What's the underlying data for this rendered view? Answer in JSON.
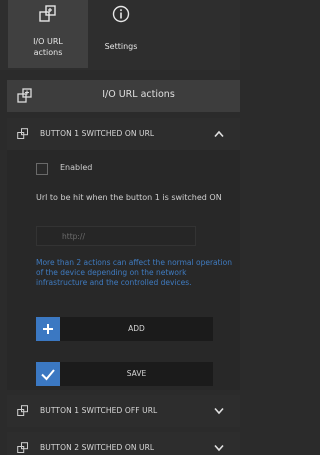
{
  "tabs": [
    {
      "label_line1": "I/O URL",
      "label_line2": "actions"
    },
    {
      "label": "Settings"
    }
  ],
  "section": {
    "title": "I/O URL actions"
  },
  "accordion": [
    {
      "title": "BUTTON 1 SWITCHED ON URL",
      "expanded": true
    },
    {
      "title": "BUTTON 1 SWITCHED OFF URL",
      "expanded": false
    },
    {
      "title": "BUTTON 2 SWITCHED ON URL",
      "expanded": false
    }
  ],
  "form": {
    "enabled_label": "Enabled",
    "enabled_checked": false,
    "url_label": "Url to be hit when the button 1 is switched ON",
    "url_placeholder": "http://",
    "warning": "More than 2 actions can affect the normal operation of the device depending on the network infrastructure and the controlled devices.",
    "add_label": "ADD",
    "save_label": "SAVE"
  },
  "colors": {
    "accent": "#3b78c2",
    "warning": "#3f7bc0",
    "background": "#2b2b2b"
  },
  "icons": [
    "io-url-icon",
    "info-icon",
    "plus-icon",
    "check-icon",
    "chevron-up-icon",
    "chevron-down-icon"
  ]
}
